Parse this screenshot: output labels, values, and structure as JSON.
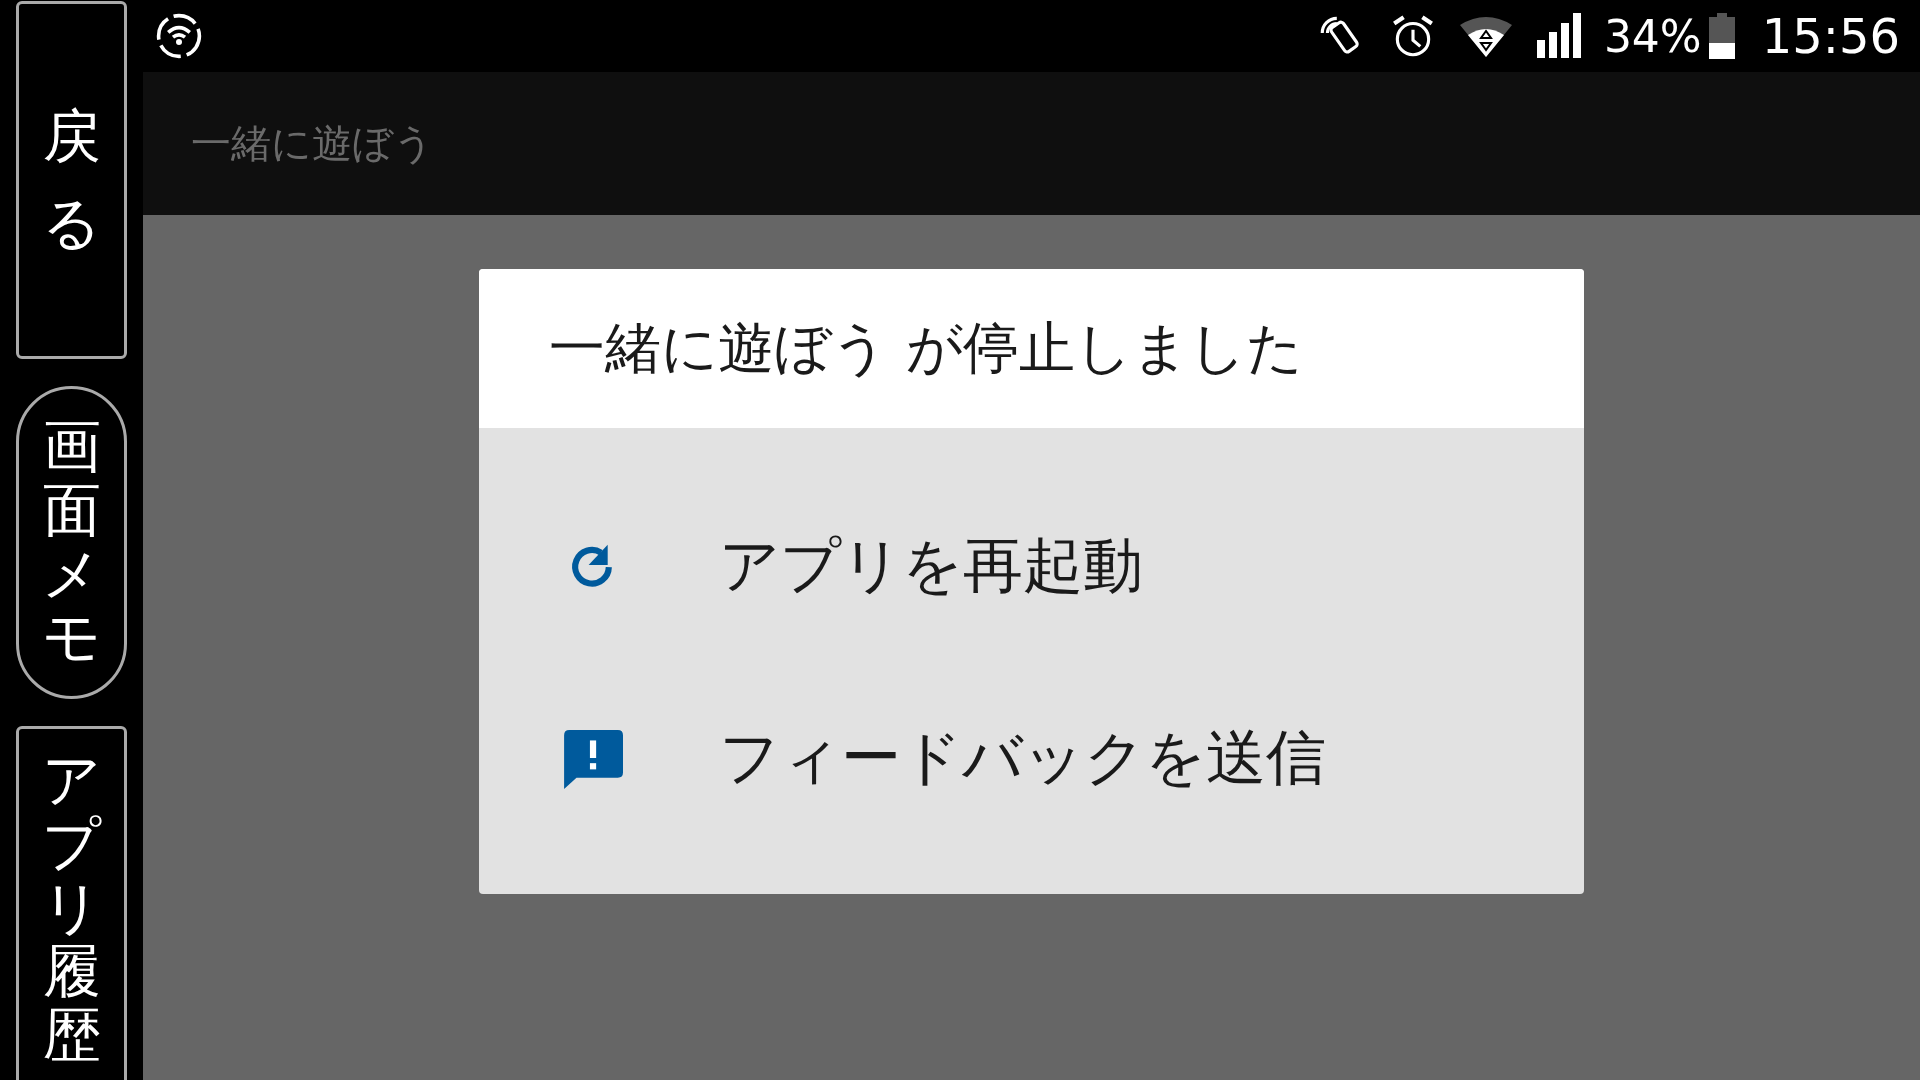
{
  "nav_buttons": [
    {
      "label": "戻る",
      "kind": "rect"
    },
    {
      "label": "画面メモ",
      "kind": "pill"
    },
    {
      "label": "アプリ履歴",
      "kind": "rect"
    }
  ],
  "status_bar": {
    "battery": "34%",
    "time": "15:56"
  },
  "app_bar": {
    "title": "一緒に遊ぼう"
  },
  "dialog": {
    "title": "一緒に遊ぼう が停止しました",
    "options": [
      {
        "label": "アプリを再起動",
        "kind": "restart"
      },
      {
        "label": "フィードバックを送信",
        "kind": "feedback"
      }
    ]
  }
}
